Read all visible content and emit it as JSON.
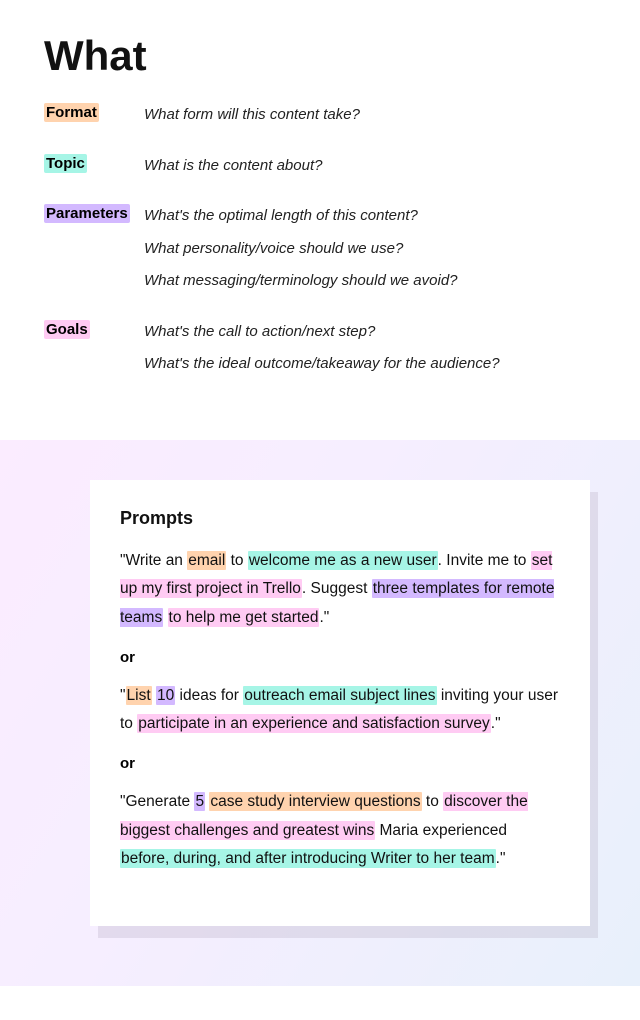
{
  "title": "What",
  "definitions": [
    {
      "label": "Format",
      "hlClass": "hl-format",
      "questions": [
        "What form will this content take?"
      ]
    },
    {
      "label": "Topic",
      "hlClass": "hl-topic",
      "questions": [
        "What is the content about?"
      ]
    },
    {
      "label": "Parameters",
      "hlClass": "hl-parameters",
      "questions": [
        "What's the optimal length of this content?",
        "What personality/voice should we use?",
        "What messaging/terminology should we avoid?"
      ]
    },
    {
      "label": "Goals",
      "hlClass": "hl-goals",
      "questions": [
        "What's the call to action/next step?",
        "What's the ideal outcome/takeaway for the audience?"
      ]
    }
  ],
  "prompts": {
    "heading": "Prompts",
    "separator": "or",
    "items": [
      {
        "segments": [
          {
            "text": "\"Write an "
          },
          {
            "text": "email",
            "hl": "hl-format"
          },
          {
            "text": " to "
          },
          {
            "text": "welcome me as a new user",
            "hl": "hl-topic"
          },
          {
            "text": ". Invite me to "
          },
          {
            "text": "set up my first project in Trello",
            "hl": "hl-goals"
          },
          {
            "text": ". Suggest "
          },
          {
            "text": "three templates for remote teams",
            "hl": "hl-parameters"
          },
          {
            "text": " "
          },
          {
            "text": "to help me get started",
            "hl": "hl-goals"
          },
          {
            "text": ".\""
          }
        ]
      },
      {
        "segments": [
          {
            "text": "\""
          },
          {
            "text": "List",
            "hl": "hl-format"
          },
          {
            "text": " "
          },
          {
            "text": "10",
            "hl": "hl-parameters"
          },
          {
            "text": " ideas for "
          },
          {
            "text": "outreach email subject lines",
            "hl": "hl-topic"
          },
          {
            "text": " inviting your user to "
          },
          {
            "text": "participate in an experience and satisfaction survey",
            "hl": "hl-goals"
          },
          {
            "text": ".\""
          }
        ]
      },
      {
        "segments": [
          {
            "text": "\"Generate "
          },
          {
            "text": "5",
            "hl": "hl-parameters"
          },
          {
            "text": " "
          },
          {
            "text": "case study interview questions",
            "hl": "hl-format"
          },
          {
            "text": " to "
          },
          {
            "text": "discover the biggest challenges and greatest wins",
            "hl": "hl-goals"
          },
          {
            "text": " Maria experienced "
          },
          {
            "text": "before, during, and after introducing Writer to her team",
            "hl": "hl-topic"
          },
          {
            "text": ".\""
          }
        ]
      }
    ]
  }
}
